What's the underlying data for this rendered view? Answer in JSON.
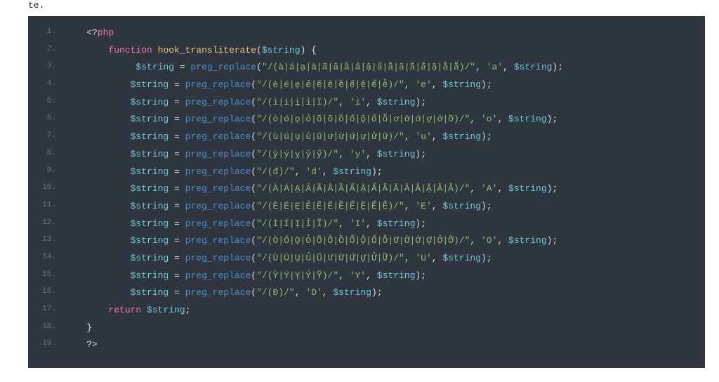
{
  "fragment": "te.",
  "code": {
    "lines": [
      {
        "n": "1.",
        "indent": "    ",
        "tokens": [
          [
            "op",
            "<?"
          ],
          [
            "kw-pink",
            "php"
          ]
        ]
      },
      {
        "n": "2.",
        "indent": "        ",
        "tokens": [
          [
            "kw-pink",
            "function"
          ],
          [
            "op",
            " "
          ],
          [
            "fn-yellow",
            "hook_transliterate"
          ],
          [
            "punct",
            "("
          ],
          [
            "var-cyan",
            "$string"
          ],
          [
            "punct",
            ")"
          ],
          [
            "op",
            " "
          ],
          [
            "punct",
            "{"
          ]
        ]
      },
      {
        "n": "3.",
        "indent": "             ",
        "tokens": [
          [
            "var-cyan",
            "$string"
          ],
          [
            "op",
            " "
          ],
          [
            "op",
            "="
          ],
          [
            "op",
            " "
          ],
          [
            "fn-blue",
            "preg_replace"
          ],
          [
            "punct",
            "("
          ],
          [
            "str-green",
            "\"/(à|á|ạ|ả|ã|â|ầ|ấ|ậ|ẩ|ẫ|ă|ằ|ắ|ặ|ẳ|ẵ)/\""
          ],
          [
            "punct",
            ","
          ],
          [
            "op",
            " "
          ],
          [
            "str-green",
            "'a'"
          ],
          [
            "punct",
            ","
          ],
          [
            "op",
            " "
          ],
          [
            "var-cyan",
            "$string"
          ],
          [
            "punct",
            ")"
          ],
          [
            "punct",
            ";"
          ]
        ]
      },
      {
        "n": "4.",
        "indent": "            ",
        "tokens": [
          [
            "var-cyan",
            "$string"
          ],
          [
            "op",
            " "
          ],
          [
            "op",
            "="
          ],
          [
            "op",
            " "
          ],
          [
            "fn-blue",
            "preg_replace"
          ],
          [
            "punct",
            "("
          ],
          [
            "str-green",
            "\"/(è|é|ẹ|ẻ|ẽ|ê|ề|ế|ệ|ể|ễ)/\""
          ],
          [
            "punct",
            ","
          ],
          [
            "op",
            " "
          ],
          [
            "str-green",
            "'e'"
          ],
          [
            "punct",
            ","
          ],
          [
            "op",
            " "
          ],
          [
            "var-cyan",
            "$string"
          ],
          [
            "punct",
            ")"
          ],
          [
            "punct",
            ";"
          ]
        ]
      },
      {
        "n": "5.",
        "indent": "            ",
        "tokens": [
          [
            "var-cyan",
            "$string"
          ],
          [
            "op",
            " "
          ],
          [
            "op",
            "="
          ],
          [
            "op",
            " "
          ],
          [
            "fn-blue",
            "preg_replace"
          ],
          [
            "punct",
            "("
          ],
          [
            "str-green",
            "\"/(ì|í|ị|ỉ|ĩ)/\""
          ],
          [
            "punct",
            ","
          ],
          [
            "op",
            " "
          ],
          [
            "str-green",
            "'i'"
          ],
          [
            "punct",
            ","
          ],
          [
            "op",
            " "
          ],
          [
            "var-cyan",
            "$string"
          ],
          [
            "punct",
            ")"
          ],
          [
            "punct",
            ";"
          ]
        ]
      },
      {
        "n": "6.",
        "indent": "            ",
        "tokens": [
          [
            "var-cyan",
            "$string"
          ],
          [
            "op",
            " "
          ],
          [
            "op",
            "="
          ],
          [
            "op",
            " "
          ],
          [
            "fn-blue",
            "preg_replace"
          ],
          [
            "punct",
            "("
          ],
          [
            "str-green",
            "\"/(ò|ó|ọ|ỏ|õ|ô|ồ|ố|ộ|ổ|ỗ|ơ|ờ|ớ|ợ|ở|ỡ)/\""
          ],
          [
            "punct",
            ","
          ],
          [
            "op",
            " "
          ],
          [
            "str-green",
            "'o'"
          ],
          [
            "punct",
            ","
          ],
          [
            "op",
            " "
          ],
          [
            "var-cyan",
            "$string"
          ],
          [
            "punct",
            ")"
          ],
          [
            "punct",
            ";"
          ]
        ]
      },
      {
        "n": "7.",
        "indent": "            ",
        "tokens": [
          [
            "var-cyan",
            "$string"
          ],
          [
            "op",
            " "
          ],
          [
            "op",
            "="
          ],
          [
            "op",
            " "
          ],
          [
            "fn-blue",
            "preg_replace"
          ],
          [
            "punct",
            "("
          ],
          [
            "str-green",
            "\"/(ù|ú|ụ|ủ|ũ|ư|ừ|ứ|ự|ử|ữ)/\""
          ],
          [
            "punct",
            ","
          ],
          [
            "op",
            " "
          ],
          [
            "str-green",
            "'u'"
          ],
          [
            "punct",
            ","
          ],
          [
            "op",
            " "
          ],
          [
            "var-cyan",
            "$string"
          ],
          [
            "punct",
            ")"
          ],
          [
            "punct",
            ";"
          ]
        ]
      },
      {
        "n": "8.",
        "indent": "            ",
        "tokens": [
          [
            "var-cyan",
            "$string"
          ],
          [
            "op",
            " "
          ],
          [
            "op",
            "="
          ],
          [
            "op",
            " "
          ],
          [
            "fn-blue",
            "preg_replace"
          ],
          [
            "punct",
            "("
          ],
          [
            "str-green",
            "\"/(ỳ|ý|ỵ|ỷ|ỹ)/\""
          ],
          [
            "punct",
            ","
          ],
          [
            "op",
            " "
          ],
          [
            "str-green",
            "'y'"
          ],
          [
            "punct",
            ","
          ],
          [
            "op",
            " "
          ],
          [
            "var-cyan",
            "$string"
          ],
          [
            "punct",
            ")"
          ],
          [
            "punct",
            ";"
          ]
        ]
      },
      {
        "n": "9.",
        "indent": "            ",
        "tokens": [
          [
            "var-cyan",
            "$string"
          ],
          [
            "op",
            " "
          ],
          [
            "op",
            "="
          ],
          [
            "op",
            " "
          ],
          [
            "fn-blue",
            "preg_replace"
          ],
          [
            "punct",
            "("
          ],
          [
            "str-green",
            "\"/(đ)/\""
          ],
          [
            "punct",
            ","
          ],
          [
            "op",
            " "
          ],
          [
            "str-green",
            "'d'"
          ],
          [
            "punct",
            ","
          ],
          [
            "op",
            " "
          ],
          [
            "var-cyan",
            "$string"
          ],
          [
            "punct",
            ")"
          ],
          [
            "punct",
            ";"
          ]
        ]
      },
      {
        "n": "10.",
        "indent": "            ",
        "tokens": [
          [
            "var-cyan",
            "$string"
          ],
          [
            "op",
            " "
          ],
          [
            "op",
            "="
          ],
          [
            "op",
            " "
          ],
          [
            "fn-blue",
            "preg_replace"
          ],
          [
            "punct",
            "("
          ],
          [
            "str-green",
            "\"/(À|Á|Ạ|Ả|Ã|Â|Ầ|Ấ|Ậ|Ẩ|Ẫ|Ă|Ằ|Ắ|Ặ|Ẳ|Ẵ)/\""
          ],
          [
            "punct",
            ","
          ],
          [
            "op",
            " "
          ],
          [
            "str-green",
            "'A'"
          ],
          [
            "punct",
            ","
          ],
          [
            "op",
            " "
          ],
          [
            "var-cyan",
            "$string"
          ],
          [
            "punct",
            ")"
          ],
          [
            "punct",
            ";"
          ]
        ]
      },
      {
        "n": "11.",
        "indent": "            ",
        "tokens": [
          [
            "var-cyan",
            "$string"
          ],
          [
            "op",
            " "
          ],
          [
            "op",
            "="
          ],
          [
            "op",
            " "
          ],
          [
            "fn-blue",
            "preg_replace"
          ],
          [
            "punct",
            "("
          ],
          [
            "str-green",
            "\"/(È|É|Ẹ|Ẻ|Ẽ|Ê|Ề|Ế|Ệ|Ể|Ễ)/\""
          ],
          [
            "punct",
            ","
          ],
          [
            "op",
            " "
          ],
          [
            "str-green",
            "'E'"
          ],
          [
            "punct",
            ","
          ],
          [
            "op",
            " "
          ],
          [
            "var-cyan",
            "$string"
          ],
          [
            "punct",
            ")"
          ],
          [
            "punct",
            ";"
          ]
        ]
      },
      {
        "n": "12.",
        "indent": "            ",
        "tokens": [
          [
            "var-cyan",
            "$string"
          ],
          [
            "op",
            " "
          ],
          [
            "op",
            "="
          ],
          [
            "op",
            " "
          ],
          [
            "fn-blue",
            "preg_replace"
          ],
          [
            "punct",
            "("
          ],
          [
            "str-green",
            "\"/(Ì|Í|Ị|Ỉ|Ĩ)/\""
          ],
          [
            "punct",
            ","
          ],
          [
            "op",
            " "
          ],
          [
            "str-green",
            "'I'"
          ],
          [
            "punct",
            ","
          ],
          [
            "op",
            " "
          ],
          [
            "var-cyan",
            "$string"
          ],
          [
            "punct",
            ")"
          ],
          [
            "punct",
            ";"
          ]
        ]
      },
      {
        "n": "13.",
        "indent": "            ",
        "tokens": [
          [
            "var-cyan",
            "$string"
          ],
          [
            "op",
            " "
          ],
          [
            "op",
            "="
          ],
          [
            "op",
            " "
          ],
          [
            "fn-blue",
            "preg_replace"
          ],
          [
            "punct",
            "("
          ],
          [
            "str-green",
            "\"/(Ò|Ó|Ọ|Ỏ|Õ|Ô|Ồ|Ố|Ộ|Ổ|Ỗ|Ơ|Ờ|Ớ|Ợ|Ở|Ỡ)/\""
          ],
          [
            "punct",
            ","
          ],
          [
            "op",
            " "
          ],
          [
            "str-green",
            "'O'"
          ],
          [
            "punct",
            ","
          ],
          [
            "op",
            " "
          ],
          [
            "var-cyan",
            "$string"
          ],
          [
            "punct",
            ")"
          ],
          [
            "punct",
            ";"
          ]
        ]
      },
      {
        "n": "14.",
        "indent": "            ",
        "tokens": [
          [
            "var-cyan",
            "$string"
          ],
          [
            "op",
            " "
          ],
          [
            "op",
            "="
          ],
          [
            "op",
            " "
          ],
          [
            "fn-blue",
            "preg_replace"
          ],
          [
            "punct",
            "("
          ],
          [
            "str-green",
            "\"/(Ù|Ú|Ụ|Ủ|Ũ|Ư|Ừ|Ứ|Ự|Ử|Ữ)/\""
          ],
          [
            "punct",
            ","
          ],
          [
            "op",
            " "
          ],
          [
            "str-green",
            "'U'"
          ],
          [
            "punct",
            ","
          ],
          [
            "op",
            " "
          ],
          [
            "var-cyan",
            "$string"
          ],
          [
            "punct",
            ")"
          ],
          [
            "punct",
            ";"
          ]
        ]
      },
      {
        "n": "15.",
        "indent": "            ",
        "tokens": [
          [
            "var-cyan",
            "$string"
          ],
          [
            "op",
            " "
          ],
          [
            "op",
            "="
          ],
          [
            "op",
            " "
          ],
          [
            "fn-blue",
            "preg_replace"
          ],
          [
            "punct",
            "("
          ],
          [
            "str-green",
            "\"/(Ỳ|Ý|Ỵ|Ỷ|Ỹ)/\""
          ],
          [
            "punct",
            ","
          ],
          [
            "op",
            " "
          ],
          [
            "str-green",
            "'Y'"
          ],
          [
            "punct",
            ","
          ],
          [
            "op",
            " "
          ],
          [
            "var-cyan",
            "$string"
          ],
          [
            "punct",
            ")"
          ],
          [
            "punct",
            ";"
          ]
        ]
      },
      {
        "n": "16.",
        "indent": "            ",
        "tokens": [
          [
            "var-cyan",
            "$string"
          ],
          [
            "op",
            " "
          ],
          [
            "op",
            "="
          ],
          [
            "op",
            " "
          ],
          [
            "fn-blue",
            "preg_replace"
          ],
          [
            "punct",
            "("
          ],
          [
            "str-green",
            "\"/(Đ)/\""
          ],
          [
            "punct",
            ","
          ],
          [
            "op",
            " "
          ],
          [
            "str-green",
            "'D'"
          ],
          [
            "punct",
            ","
          ],
          [
            "op",
            " "
          ],
          [
            "var-cyan",
            "$string"
          ],
          [
            "punct",
            ")"
          ],
          [
            "punct",
            ";"
          ]
        ]
      },
      {
        "n": "17.",
        "indent": "        ",
        "tokens": [
          [
            "kw-pink",
            "return"
          ],
          [
            "op",
            " "
          ],
          [
            "var-cyan",
            "$string"
          ],
          [
            "punct",
            ";"
          ]
        ]
      },
      {
        "n": "18.",
        "indent": "    ",
        "tokens": [
          [
            "punct",
            "}"
          ]
        ]
      },
      {
        "n": "19.",
        "indent": "    ",
        "tokens": [
          [
            "op",
            "?>"
          ]
        ]
      }
    ]
  }
}
